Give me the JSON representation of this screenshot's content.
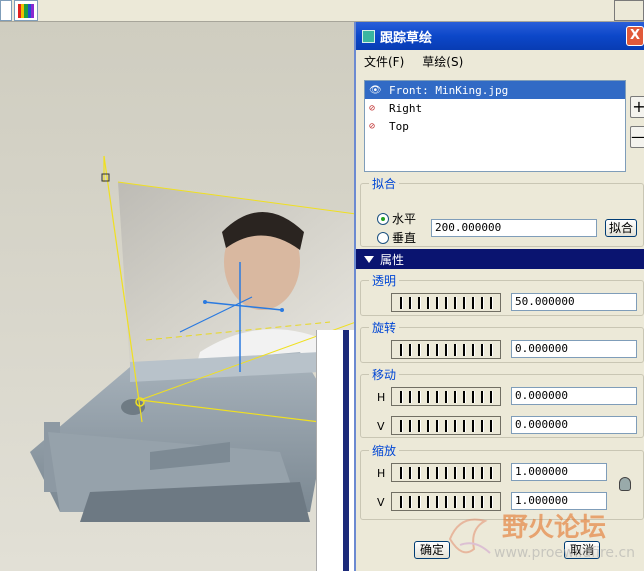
{
  "dialog": {
    "title": "跟踪草绘",
    "close_label": "X",
    "menu": [
      {
        "label": "文件(F)"
      },
      {
        "label": "草绘(S)"
      }
    ],
    "images": [
      {
        "label": "Front: MinKing.jpg",
        "selected": true
      },
      {
        "label": "Right",
        "selected": false
      },
      {
        "label": "Top",
        "selected": false
      }
    ],
    "add_label": "+",
    "remove_label": "—",
    "fit": {
      "legend": "拟合",
      "horizontal_label": "水平",
      "vertical_label": "垂直",
      "selected": "horizontal",
      "value": "200.000000",
      "fit_button": "拟合"
    },
    "properties": {
      "header": "属性",
      "transparency": {
        "legend": "透明",
        "value": "50.000000"
      },
      "rotation": {
        "legend": "旋转",
        "value": "0.000000"
      },
      "move": {
        "legend": "移动",
        "h_label": "H",
        "h_value": "0.000000",
        "v_label": "V",
        "v_value": "0.000000"
      },
      "scale": {
        "legend": "缩放",
        "h_label": "H",
        "h_value": "1.000000",
        "v_label": "V",
        "v_value": "1.000000"
      }
    },
    "ok_label": "确定",
    "cancel_label": "取消"
  },
  "watermark": {
    "title": "野火论坛",
    "url": "www.proewildfire.cn"
  },
  "colors": {
    "titlebar": "#0c47c9",
    "selection": "#316ac5",
    "props_header": "#0a1470",
    "legend": "#0046d5"
  }
}
